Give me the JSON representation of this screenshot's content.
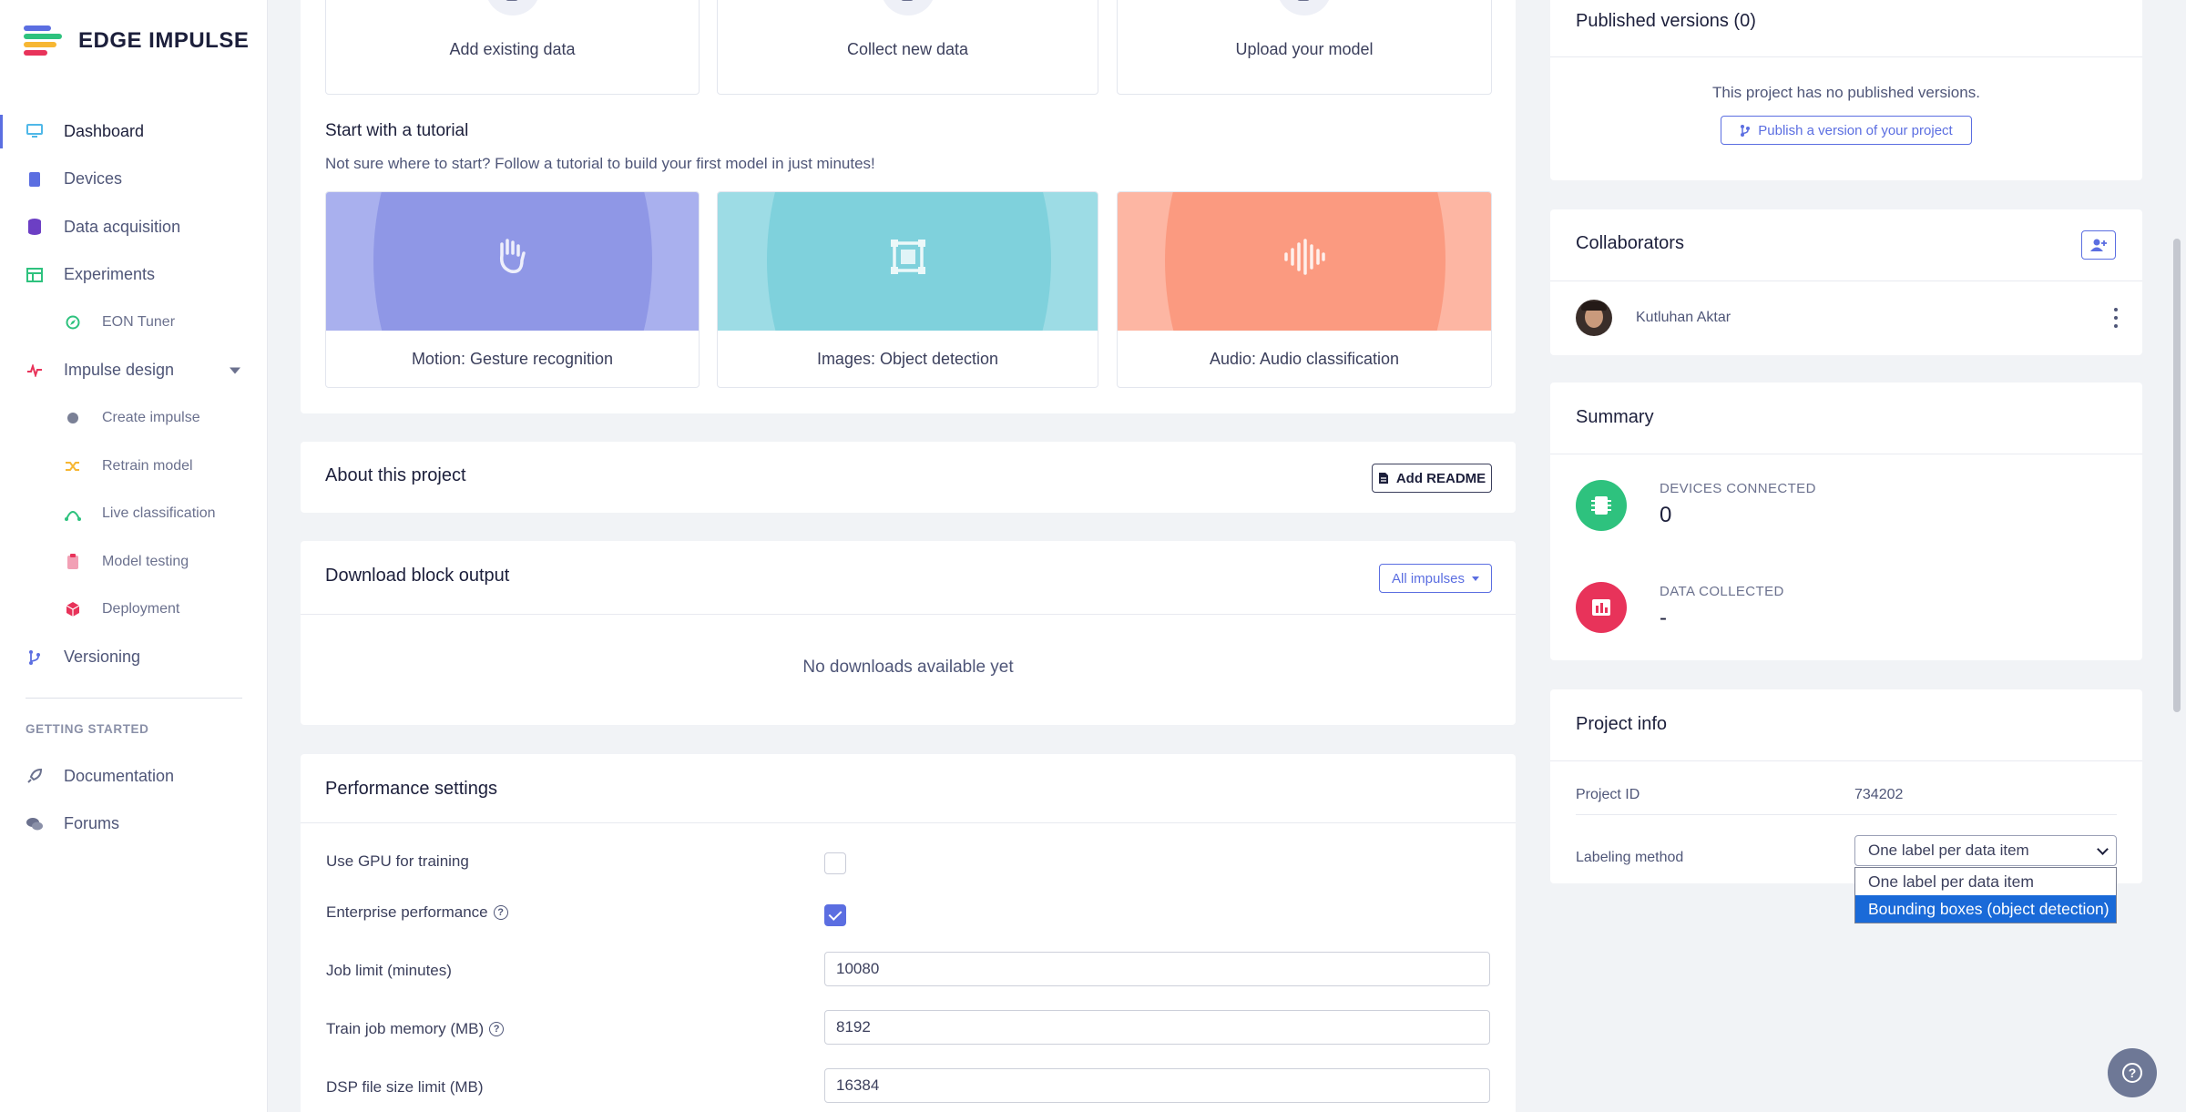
{
  "brand": {
    "name": "EDGE IMPULSE"
  },
  "sidebar": {
    "items": [
      {
        "label": "Dashboard",
        "icon": "monitor-icon",
        "active": true
      },
      {
        "label": "Devices",
        "icon": "chip-icon"
      },
      {
        "label": "Data acquisition",
        "icon": "database-icon"
      },
      {
        "label": "Experiments",
        "icon": "table-icon"
      },
      {
        "label": "EON Tuner",
        "icon": "compass-icon",
        "sub": true
      },
      {
        "label": "Impulse design",
        "icon": "pulse-icon"
      },
      {
        "label": "Create impulse",
        "icon": "dot-icon",
        "sub": true
      },
      {
        "label": "Retrain model",
        "icon": "shuffle-icon",
        "sub": true
      },
      {
        "label": "Live classification",
        "icon": "graph-icon",
        "sub": true
      },
      {
        "label": "Model testing",
        "icon": "clipboard-icon",
        "sub": true
      },
      {
        "label": "Deployment",
        "icon": "cube-icon",
        "sub": true
      },
      {
        "label": "Versioning",
        "icon": "branch-icon"
      }
    ],
    "section_title": "GETTING STARTED",
    "bottom_items": [
      {
        "label": "Documentation",
        "icon": "rocket-icon"
      },
      {
        "label": "Forums",
        "icon": "chat-icon"
      }
    ]
  },
  "sources": {
    "add_existing": "Add existing data",
    "collect_new": "Collect new data",
    "upload_model": "Upload your model"
  },
  "tutorial": {
    "title": "Start with a tutorial",
    "subtitle": "Not sure where to start? Follow a tutorial to build your first model in just minutes!",
    "cards": [
      {
        "label": "Motion: Gesture recognition",
        "color": "#8f97e6",
        "glyph": "✋"
      },
      {
        "label": "Images: Object detection",
        "color": "#7fd1dc",
        "glyph": "▣"
      },
      {
        "label": "Audio: Audio classification",
        "color": "#fb9a80",
        "glyph": "⫼"
      }
    ]
  },
  "about": {
    "title": "About this project",
    "readme_button": "Add README"
  },
  "download": {
    "title": "Download block output",
    "filter_button": "All impulses",
    "empty": "No downloads available yet"
  },
  "performance": {
    "title": "Performance settings",
    "gpu_label": "Use GPU for training",
    "gpu_checked": false,
    "enterprise_label": "Enterprise performance",
    "enterprise_checked": true,
    "job_limit_label": "Job limit (minutes)",
    "job_limit_value": "10080",
    "train_memory_label": "Train job memory (MB)",
    "train_memory_value": "8192",
    "dsp_limit_label": "DSP file size limit (MB)",
    "dsp_limit_value": "16384"
  },
  "published": {
    "title": "Published versions (0)",
    "empty": "This project has no published versions.",
    "publish_button": "Publish a version of your project"
  },
  "collaborators": {
    "title": "Collaborators",
    "members": [
      {
        "name": "Kutluhan Aktar"
      }
    ]
  },
  "summary": {
    "title": "Summary",
    "devices_label": "DEVICES CONNECTED",
    "devices_value": "0",
    "data_label": "DATA COLLECTED",
    "data_value": "-"
  },
  "project_info": {
    "title": "Project info",
    "id_label": "Project ID",
    "id_value": "734202",
    "labeling_label": "Labeling method",
    "labeling_value": "One label per data item",
    "labeling_options": [
      "One label per data item",
      "Bounding boxes (object detection)"
    ],
    "labeling_highlighted": "Bounding boxes (object detection)"
  },
  "colors": {
    "accent": "#5b6ee1",
    "devices_circle": "#2ec27e",
    "data_circle": "#e8335a",
    "select_highlight": "#1a6ad8"
  }
}
